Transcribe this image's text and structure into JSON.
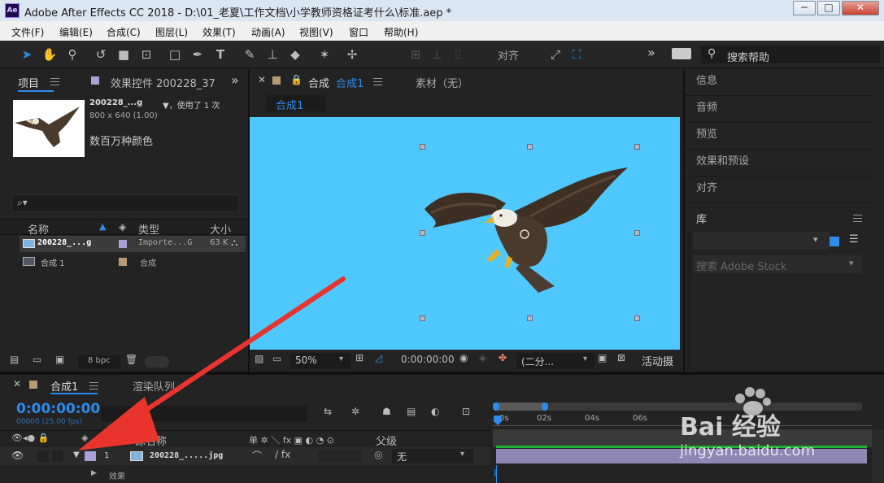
{
  "window": {
    "title": "Adobe After Effects CC 2018 - D:\\01_老夏\\工作文档\\小学教师资格证考什么\\标准.aep *",
    "app_icon": "Ae",
    "minimize": "─",
    "maximize": "□",
    "close": "✕"
  },
  "menu": [
    "文件(F)",
    "编辑(E)",
    "合成(C)",
    "图层(L)",
    "效果(T)",
    "动画(A)",
    "视图(V)",
    "窗口",
    "帮助(H)"
  ],
  "toolbar": {
    "snap_label": "对齐",
    "search_help": "搜索帮助",
    "more": "»"
  },
  "project_panel": {
    "tab_project": "项目",
    "tab_effects": "效果控件 200228_37",
    "more": "»",
    "preview": {
      "filename": "200228_...g",
      "used": "▼，使用了 1 次",
      "dims": "800 x 640 (1.00)",
      "colors": "数百万种颜色"
    },
    "search_placeholder": "⌕▾",
    "columns": {
      "name": "名称",
      "type": "类型",
      "size": "大小"
    },
    "items": [
      {
        "name": "200228_...g",
        "type": "Importe...G",
        "size": "63 K"
      },
      {
        "name": "合成 1",
        "type": "合成",
        "size": ""
      }
    ],
    "bpc": "8 bpc"
  },
  "comp_panel": {
    "tab_comp": "合成",
    "tab_comp_name": "合成1",
    "tab_footage": "素材（无）",
    "flow_tab": "合成1",
    "zoom": "50%",
    "timecode": "0:00:00:00",
    "resolution": "(二分...",
    "active_camera": "活动摄"
  },
  "right_panel": {
    "items": [
      "信息",
      "音频",
      "预览",
      "效果和预设",
      "对齐"
    ],
    "library": "库",
    "stock_search": "搜索 Adobe Stock"
  },
  "timeline": {
    "tab_comp": "合成1",
    "tab_render": "渲染队列",
    "timecode": "0:00:00:00",
    "fps": "00000 (25.00 fps)",
    "col_source": "源名称",
    "col_switches": "单 ✲ ＼ fx ▣ ◐ ◔ ⊙",
    "col_parent": "父级",
    "ruler": [
      "0s",
      "02s",
      "04s",
      "06s"
    ],
    "layer": {
      "index": "1",
      "name": "200228_.....jpg",
      "parent": "无"
    },
    "effects_label": "效果"
  },
  "watermark": {
    "text": "Bai 经验",
    "url": "jingyan.baidu.com"
  },
  "colors": {
    "accent": "#2d8ceb",
    "comp_bg": "#4fc8ff",
    "annotation_arrow": "#e8342c"
  }
}
